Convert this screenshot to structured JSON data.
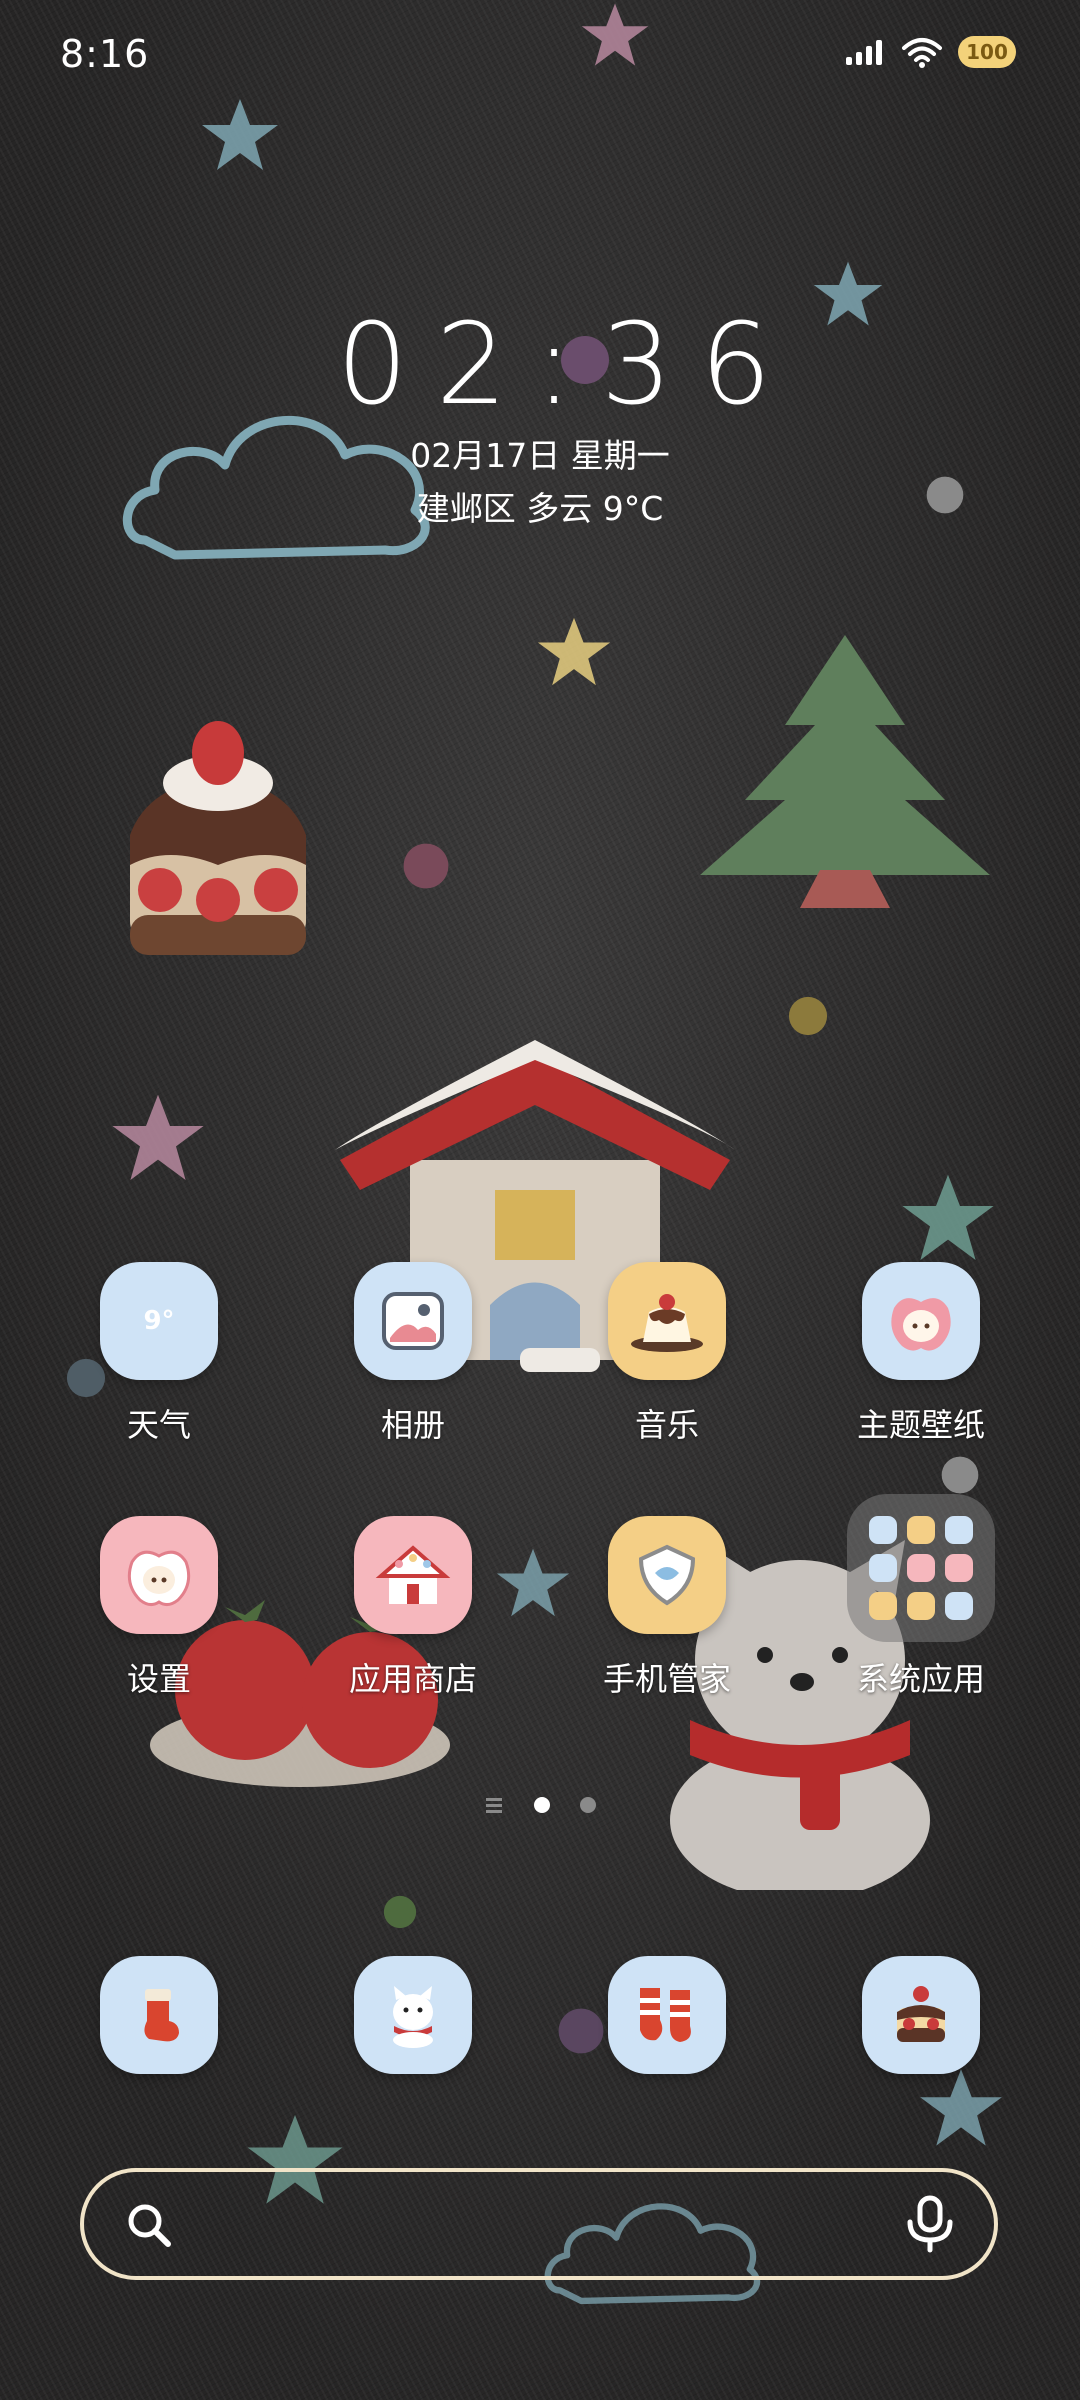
{
  "status_bar": {
    "time": "8:16",
    "battery": "100",
    "icons": [
      "signal-icon",
      "wifi-icon",
      "battery-icon"
    ]
  },
  "clock_widget": {
    "time": "02:36",
    "date": "02月17日 星期一",
    "weather": "建邺区 多云 9°C"
  },
  "apps": [
    {
      "label": "天气",
      "icon": "weather-icon",
      "badge": "9°"
    },
    {
      "label": "相册",
      "icon": "gallery-icon"
    },
    {
      "label": "音乐",
      "icon": "music-icon"
    },
    {
      "label": "主题壁纸",
      "icon": "theme-icon"
    },
    {
      "label": "设置",
      "icon": "settings-icon"
    },
    {
      "label": "应用商店",
      "icon": "app-store-icon"
    },
    {
      "label": "手机管家",
      "icon": "phone-manager-icon"
    },
    {
      "label": "系统应用",
      "icon": "folder-icon"
    }
  ],
  "pager": {
    "pages": 2,
    "current": 1
  },
  "dock": [
    {
      "icon": "stocking-app-icon"
    },
    {
      "icon": "dog-app-icon"
    },
    {
      "icon": "socks-app-icon"
    },
    {
      "icon": "cake-app-icon"
    }
  ],
  "search": {
    "placeholder": ""
  },
  "colors": {
    "background": "#2b2a2a",
    "icon_blue": "#cfe3f6",
    "icon_pink": "#f6b7bd",
    "icon_yellow": "#f4cf86",
    "search_border": "#f1e4c8"
  }
}
